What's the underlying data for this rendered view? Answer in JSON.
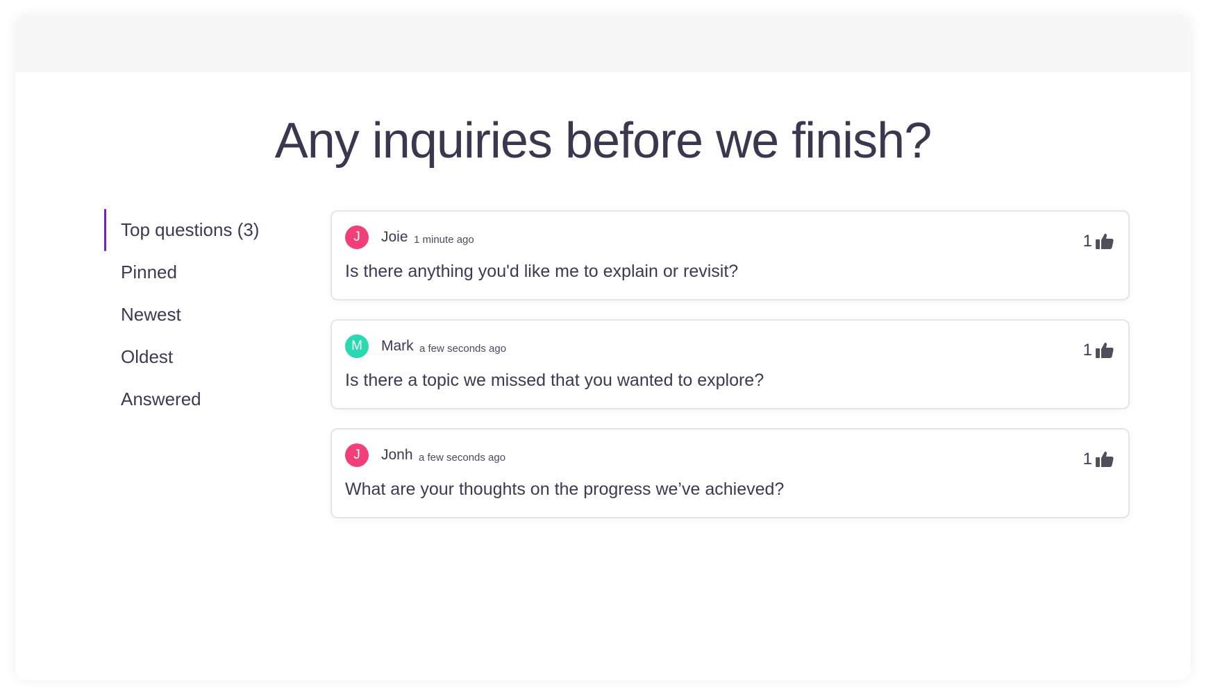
{
  "page": {
    "title": "Any inquiries before we finish?"
  },
  "nav": {
    "items": [
      {
        "label": "Top questions (3)",
        "active": true
      },
      {
        "label": "Pinned"
      },
      {
        "label": "Newest"
      },
      {
        "label": "Oldest"
      },
      {
        "label": "Answered"
      }
    ]
  },
  "questions": [
    {
      "initial": "J",
      "author": "Joie",
      "time": "1 minute ago",
      "text": "Is there anything you'd like me to explain or revisit?",
      "votes": "1",
      "avatar_color": "#f23f78"
    },
    {
      "initial": "M",
      "author": "Mark",
      "time": "a few seconds ago",
      "text": "Is there a topic we missed that you wanted to explore?",
      "votes": "1",
      "avatar_color": "#2ad9b0"
    },
    {
      "initial": "J",
      "author": "Jonh",
      "time": "a few seconds ago",
      "text": "What are your thoughts on the progress we’ve achieved?",
      "votes": "1",
      "avatar_color": "#f23f78"
    }
  ],
  "icons": {
    "vote": "thumbs-up-icon"
  },
  "colors": {
    "accent": "#7a1fbf",
    "text": "#3a3a55"
  }
}
